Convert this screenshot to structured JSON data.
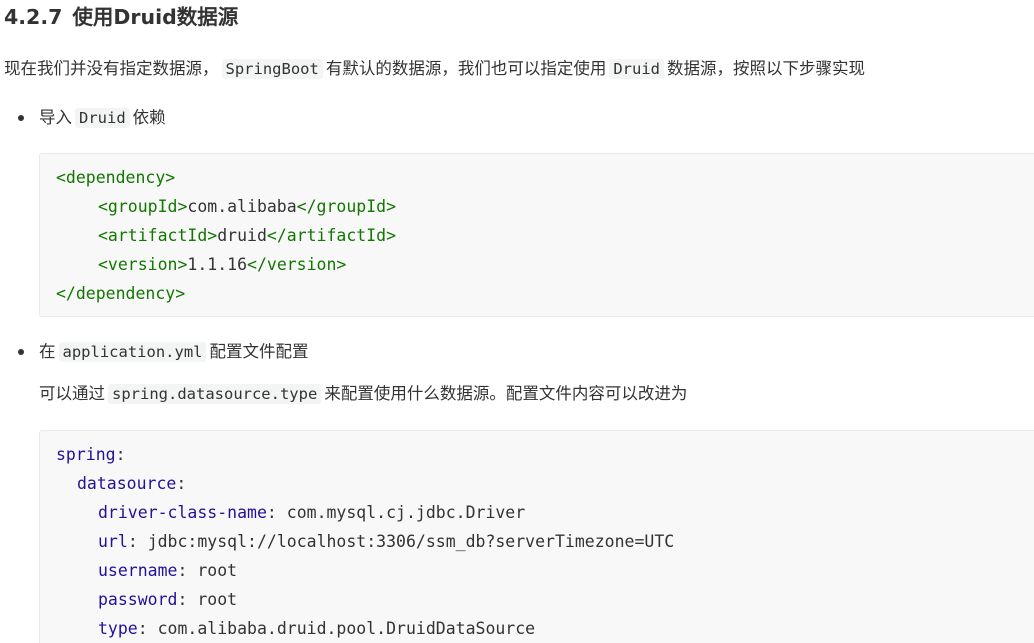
{
  "section": {
    "number": "4.2.7",
    "title": "使用Druid数据源"
  },
  "intro": {
    "part1": "现在我们并没有指定数据源，",
    "code1": "SpringBoot",
    "part2": "有默认的数据源，我们也可以指定使用",
    "code2": "Druid",
    "part3": "数据源，按照以下步骤实现"
  },
  "step1": {
    "part1": "导入",
    "code": "Druid",
    "part2": "依赖"
  },
  "xml_block": {
    "lines": [
      {
        "open": "<dependency>",
        "text": "",
        "close": ""
      },
      {
        "open": "<groupId>",
        "text": "com.alibaba",
        "close": "</groupId>"
      },
      {
        "open": "<artifactId>",
        "text": "druid",
        "close": "</artifactId>"
      },
      {
        "open": "<version>",
        "text": "1.1.16",
        "close": "</version>"
      },
      {
        "open": "",
        "text": "",
        "close": "</dependency>"
      }
    ]
  },
  "step2": {
    "part1": "在",
    "code": "application.yml",
    "part2": "配置文件配置"
  },
  "step2_desc": {
    "part1": "可以通过",
    "code": "spring.datasource.type",
    "part2": "来配置使用什么数据源。配置文件内容可以改进为"
  },
  "yaml_block": {
    "lines": [
      {
        "key": "spring",
        "value": ""
      },
      {
        "key": "datasource",
        "value": ""
      },
      {
        "key": "driver-class-name",
        "value": "com.mysql.cj.jdbc.Driver"
      },
      {
        "key": "url",
        "value": "jdbc:mysql://localhost:3306/ssm_db?serverTimezone=UTC"
      },
      {
        "key": "username",
        "value": "root"
      },
      {
        "key": "password",
        "value": "root"
      },
      {
        "key": "type",
        "value": "com.alibaba.druid.pool.DruidDataSource"
      }
    ]
  },
  "colors": {
    "xml_tag": "#117700",
    "yaml_key": "#221199",
    "code_background": "#f8f8f8",
    "inline_code_background": "#f3f4f4"
  }
}
